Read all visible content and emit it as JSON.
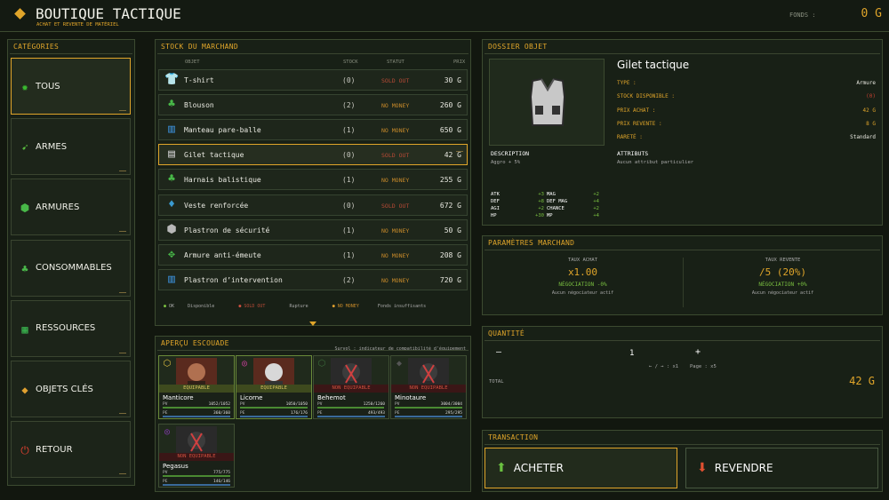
{
  "header": {
    "title": "BOUTIQUE TACTIQUE",
    "subtitle": "ACHAT ET REVENTE DE MATÉRIEL",
    "funds_label": "FONDS :",
    "funds_value": "0 G"
  },
  "categories": {
    "title": "CATÉGORIES",
    "items": [
      {
        "label": "TOUS",
        "icon": "gear-icon",
        "color": "#3ab830"
      },
      {
        "label": "ARMES",
        "icon": "rifle-icon",
        "color": "#5ac040"
      },
      {
        "label": "ARMURES",
        "icon": "armor-icon",
        "color": "#48b848"
      },
      {
        "label": "CONSOMMABLES",
        "icon": "potion-icon",
        "color": "#4ab84a"
      },
      {
        "label": "RESSOURCES",
        "icon": "crate-icon",
        "color": "#3ab850"
      },
      {
        "label": "OBJETS CLÉS",
        "icon": "key-icon",
        "color": "#e0a030"
      },
      {
        "label": "RETOUR",
        "icon": "power-icon",
        "color": "#e04030"
      }
    ]
  },
  "stock": {
    "title": "STOCK DU MARCHAND",
    "headers": [
      "OBJET",
      "STOCK",
      "STATUT",
      "PRIX"
    ],
    "rows": [
      {
        "name": "T-shirt",
        "stock": "(0)",
        "status": "SOLD OUT",
        "price": "30 G",
        "icon": "tshirt-icon",
        "status_type": "red"
      },
      {
        "name": "Blouson",
        "stock": "(2)",
        "status": "NO MONEY",
        "price": "260 G",
        "icon": "jacket-icon",
        "status_type": "org"
      },
      {
        "name": "Manteau pare-balle",
        "stock": "(1)",
        "status": "NO MONEY",
        "price": "650 G",
        "icon": "coat-icon",
        "status_type": "org"
      },
      {
        "name": "Gilet tactique",
        "stock": "(0)",
        "status": "SOLD OUT",
        "price": "42 G",
        "icon": "vest-icon",
        "status_type": "red"
      },
      {
        "name": "Harnais balistique",
        "stock": "(1)",
        "status": "NO MONEY",
        "price": "255 G",
        "icon": "harness-icon",
        "status_type": "org"
      },
      {
        "name": "Veste renforcée",
        "stock": "(0)",
        "status": "SOLD OUT",
        "price": "672 G",
        "icon": "reinforced-jacket-icon",
        "status_type": "red"
      },
      {
        "name": "Plastron de sécurité",
        "stock": "(1)",
        "status": "NO MONEY",
        "price": "50 G",
        "icon": "breastplate-icon",
        "status_type": "org"
      },
      {
        "name": "Armure anti-émeute",
        "stock": "(1)",
        "status": "NO MONEY",
        "price": "208 G",
        "icon": "riot-armor-icon",
        "status_type": "org"
      },
      {
        "name": "Plastron d’intervention",
        "stock": "(2)",
        "status": "NO MONEY",
        "price": "720 G",
        "icon": "intervention-plate-icon",
        "status_type": "org"
      }
    ],
    "legend": [
      {
        "tag": "OK",
        "text": "Disponible",
        "color": "#7ac040"
      },
      {
        "tag": "SOLD OUT",
        "text": "Rupture",
        "color": "#d05040"
      },
      {
        "tag": "NO MONEY",
        "text": "Fonds insuffisants",
        "color": "#e0a030"
      }
    ]
  },
  "squad": {
    "title": "APERÇU ESCOUADE",
    "hint": "Survol : indicateur de compatibilité d'équipement",
    "members": [
      {
        "name": "Manticore",
        "tag": "EQUIPABLE",
        "eq": true,
        "hp": "1052/1052",
        "mp": "360/360",
        "hp_frac": 1,
        "mp_frac": 1
      },
      {
        "name": "Licorne",
        "tag": "EQUIPABLE",
        "eq": true,
        "hp": "1050/1050",
        "mp": "176/176",
        "hp_frac": 1,
        "mp_frac": 1
      },
      {
        "name": "Behemot",
        "tag": "NON EQUIPABLE",
        "eq": false,
        "hp": "1250/1260",
        "mp": "493/493",
        "hp_frac": 0.99,
        "mp_frac": 1
      },
      {
        "name": "Minotaure",
        "tag": "NON EQUIPABLE",
        "eq": false,
        "hp": "3004/3004",
        "mp": "295/295",
        "hp_frac": 1,
        "mp_frac": 1
      },
      {
        "name": "Pegasus",
        "tag": "NON EQUIPABLE",
        "eq": false,
        "hp": "775/775",
        "mp": "146/146",
        "hp_frac": 1,
        "mp_frac": 1
      }
    ]
  },
  "dossier": {
    "title": "DOSSIER OBJET",
    "item_name": "Gilet tactique",
    "fields": [
      {
        "k": "TYPE :",
        "v": "Armure"
      },
      {
        "k": "STOCK DISPONIBLE :",
        "v": "(0)"
      },
      {
        "k": "PRIX ACHAT :",
        "v": "42 G"
      },
      {
        "k": "PRIX REVENTE :",
        "v": "8 G"
      },
      {
        "k": "RARETÉ :",
        "v": "Standard"
      }
    ],
    "desc_label": "DESCRIPTION",
    "desc": "Aggro + 5%",
    "attr_label": "ATTRIBUTS",
    "attr": "Aucun attribut particulier",
    "stats": [
      {
        "k": "ATK",
        "v": "+3",
        "k2": "MAG",
        "v2": "+2"
      },
      {
        "k": "DEF",
        "v": "+8",
        "k2": "DEF MAG",
        "v2": "+4"
      },
      {
        "k": "AGI",
        "v": "+2",
        "k2": "CHANCE",
        "v2": "+2"
      },
      {
        "k": "HP",
        "v": "+30",
        "k2": "MP",
        "v2": "+4"
      }
    ]
  },
  "merchant": {
    "title": "PARAMÈTRES MARCHAND",
    "buy": {
      "label": "TAUX ACHAT",
      "value": "x1.00",
      "neg": "NÉGOCIATION -0%",
      "note": "Aucun négociateur actif"
    },
    "sell": {
      "label": "TAUX REVENTE",
      "value": "/5 (20%)",
      "neg": "NÉGOCIATION +0%",
      "note": "Aucun négociateur actif"
    }
  },
  "quantity": {
    "title": "QUANTITÉ",
    "minus": "–",
    "value": "1",
    "plus": "+",
    "hint1": "← / → : x1",
    "hint2": "Page : x5",
    "total_label": "TOTAL",
    "total_value": "42 G"
  },
  "transaction": {
    "title": "TRANSACTION",
    "buy": "ACHETER",
    "sell": "REVENDRE"
  }
}
